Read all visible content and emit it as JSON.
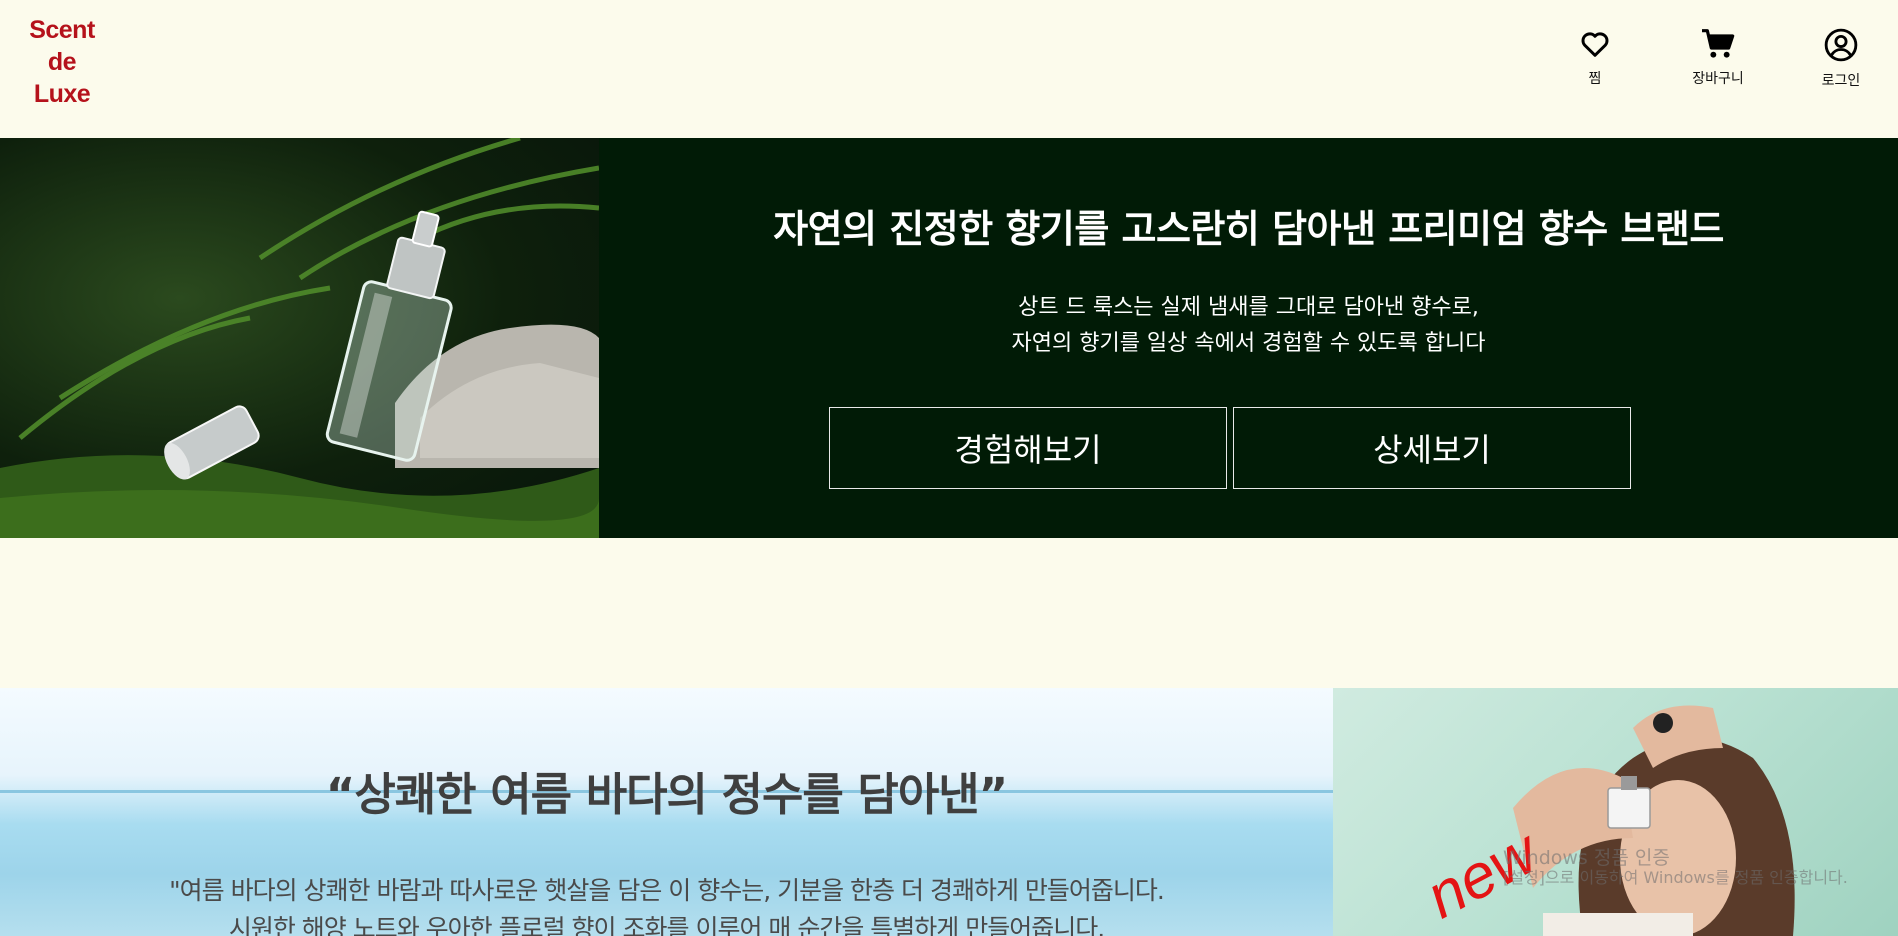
{
  "header": {
    "logo_line1": "Scent",
    "logo_line2": "de",
    "logo_line3": "Luxe",
    "nav": {
      "wishlist_label": "찜",
      "cart_label": "장바구니",
      "login_label": "로그인"
    }
  },
  "hero": {
    "title": "자연의 진정한 향기를 고스란히 담아낸 프리미엄 향수 브랜드",
    "desc_line1": "상트 드 룩스는 실제 냄새를 그대로 담아낸 향수로,",
    "desc_line2": "자연의 향기를 일상 속에서 경험할 수 있도록 합니다",
    "experience_button": "경험해보기",
    "details_button": "상세보기"
  },
  "summer": {
    "title": "“상쾌한 여름 바다의 정수를 담아낸”",
    "desc_line1": "\"여름 바다의 상쾌한 바람과 따사로운 햇살을 담은 이 향수는, 기분을 한층 더 경쾌하게 만들어줍니다.",
    "desc_line2": "시원한 해양 노트와 우아한 플로럴 향이 조화를 이루어 매 순간을 특별하게 만들어줍니다.",
    "badge": "new"
  },
  "system_watermark": {
    "line1": "Windows 정품 인증",
    "line2": "[설정]으로 이동하여 Windows를 정품 인증합니다."
  },
  "colors": {
    "background": "#fcfbec",
    "logo": "#b5121b",
    "hero_background": "#011b06",
    "badge": "#e41414"
  },
  "icons": {
    "wishlist": "heart-icon",
    "cart": "cart-icon",
    "login": "user-circle-icon"
  }
}
